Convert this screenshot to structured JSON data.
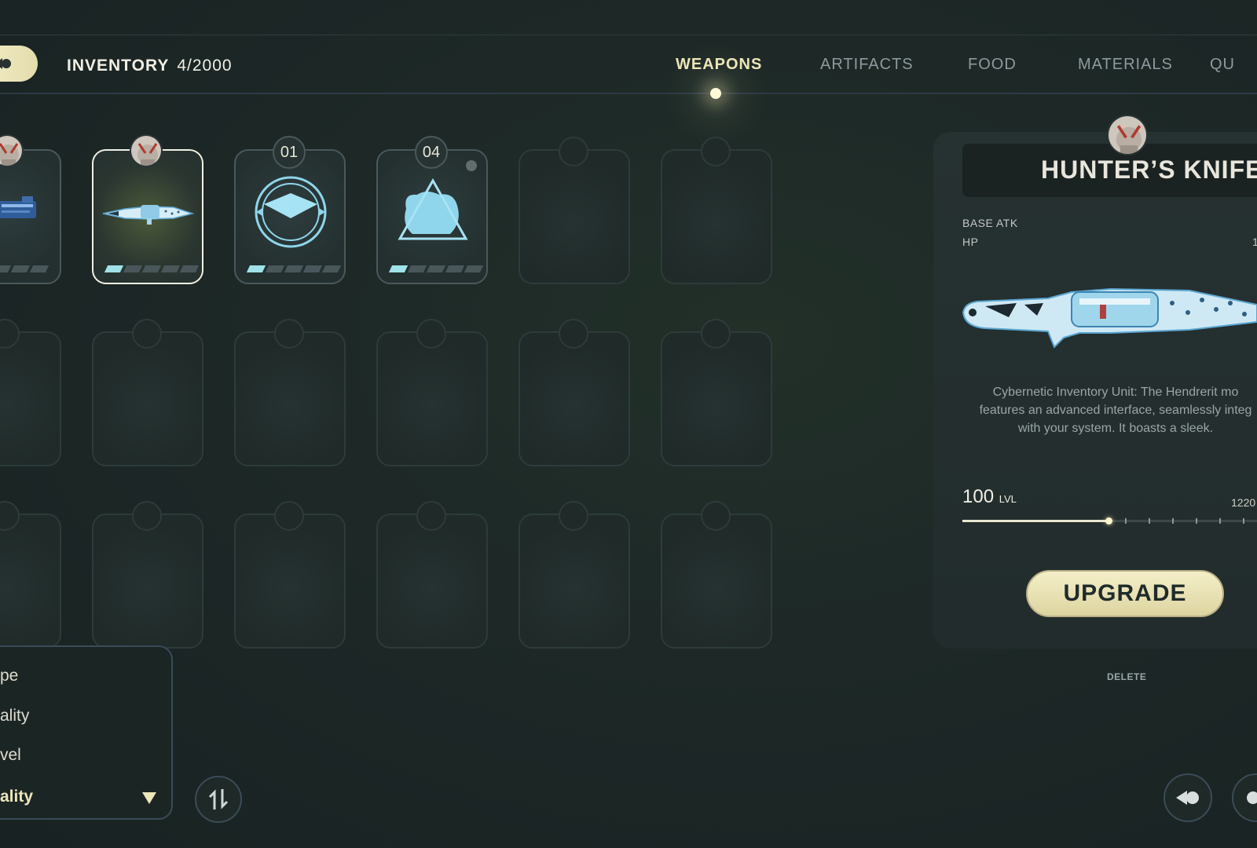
{
  "header": {
    "inventory_label": "INVENTORY",
    "inventory_count": "4/2000",
    "tabs": [
      {
        "label": "WEAPONS",
        "active": true
      },
      {
        "label": "ARTIFACTS",
        "active": false
      },
      {
        "label": "FOOD",
        "active": false
      },
      {
        "label": "MATERIALS",
        "active": false
      },
      {
        "label": "QU",
        "active": false
      }
    ]
  },
  "grid": {
    "slots": [
      {
        "kind": "weapon-blaster",
        "owner": "avatar",
        "level_pips": 5,
        "filled_pips": 0
      },
      {
        "kind": "weapon-knife",
        "owner": "avatar",
        "level_pips": 5,
        "filled_pips": 1,
        "selected": true
      },
      {
        "kind": "artifact-disc",
        "badge": "01",
        "level_pips": 5,
        "filled_pips": 1
      },
      {
        "kind": "artifact-triangle",
        "badge": "04",
        "level_pips": 5,
        "filled_pips": 1
      }
    ]
  },
  "detail": {
    "name": "HUNTER’S KNIFE",
    "stats": [
      {
        "label": "BASE ATK",
        "value": ""
      },
      {
        "label": "HP",
        "value": "1"
      }
    ],
    "description_lines": [
      "Cybernetic Inventory Unit: The Hendrerit mo",
      "features an advanced interface, seamlessly integ",
      "with your system. It boasts a sleek."
    ],
    "level": "100",
    "level_unit": "LVL",
    "max_level": "1220",
    "level_progress": 0.47,
    "upgrade_label": "UPGRADE",
    "delete_label": "DELETE"
  },
  "sort_menu": {
    "options": [
      {
        "label": "pe"
      },
      {
        "label": "ality"
      },
      {
        "label": "vel"
      },
      {
        "label": "ality",
        "selected": true
      }
    ]
  },
  "colors": {
    "accent": "#ece6b8",
    "pip_active": "#9fe3e8",
    "item_glow": "#8fd6ec"
  }
}
